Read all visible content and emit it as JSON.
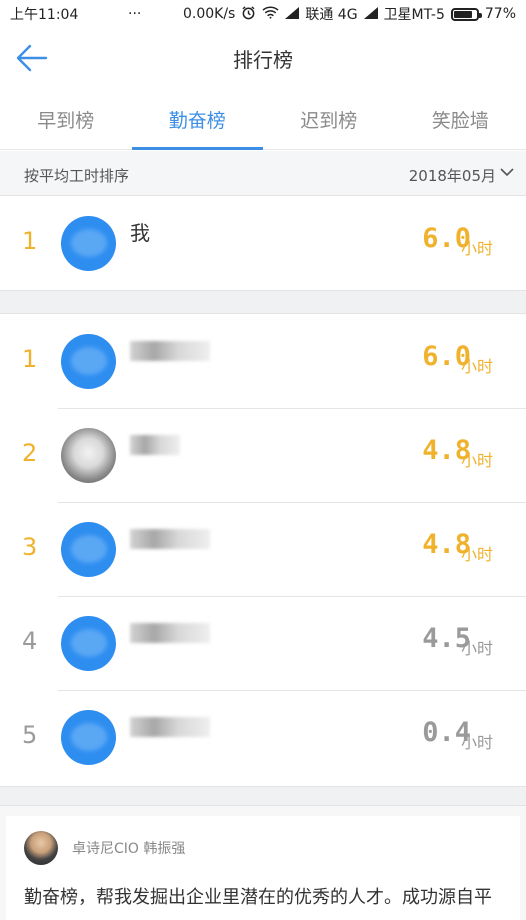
{
  "status_bar": {
    "time": "上午11:04",
    "dots": "···",
    "speed": "0.00K/s",
    "carrier1": "联通 4G",
    "carrier2": "卫星MT-5",
    "battery": "77%"
  },
  "navbar": {
    "title": "排行榜"
  },
  "tabs": [
    {
      "label": "早到榜"
    },
    {
      "label": "勤奋榜"
    },
    {
      "label": "迟到榜"
    },
    {
      "label": "笑脸墙"
    }
  ],
  "active_tab": 1,
  "sort": {
    "label": "按平均工时排序",
    "month": "2018年05月"
  },
  "me": {
    "rank": "1",
    "name": "我",
    "hours": "6.0",
    "unit": "小时"
  },
  "list": [
    {
      "rank": "1",
      "hours": "6.0",
      "unit": "小时"
    },
    {
      "rank": "2",
      "hours": "4.8",
      "unit": "小时"
    },
    {
      "rank": "3",
      "hours": "4.8",
      "unit": "小时"
    },
    {
      "rank": "4",
      "hours": "4.5",
      "unit": "小时"
    },
    {
      "rank": "5",
      "hours": "0.4",
      "unit": "小时"
    }
  ],
  "comment": {
    "author": "卓诗尼CIO 韩振强",
    "text": "勤奋榜，帮我发掘出企业里潜在的优秀的人才。成功源自平"
  },
  "colors": {
    "accent": "#3d8fe6",
    "gold": "#f0b22d",
    "grey": "#9a9a9a"
  },
  "icons": [
    "back-arrow-icon",
    "chevron-down-icon",
    "alarm-icon",
    "wifi-icon",
    "signal-icon",
    "battery-icon"
  ]
}
